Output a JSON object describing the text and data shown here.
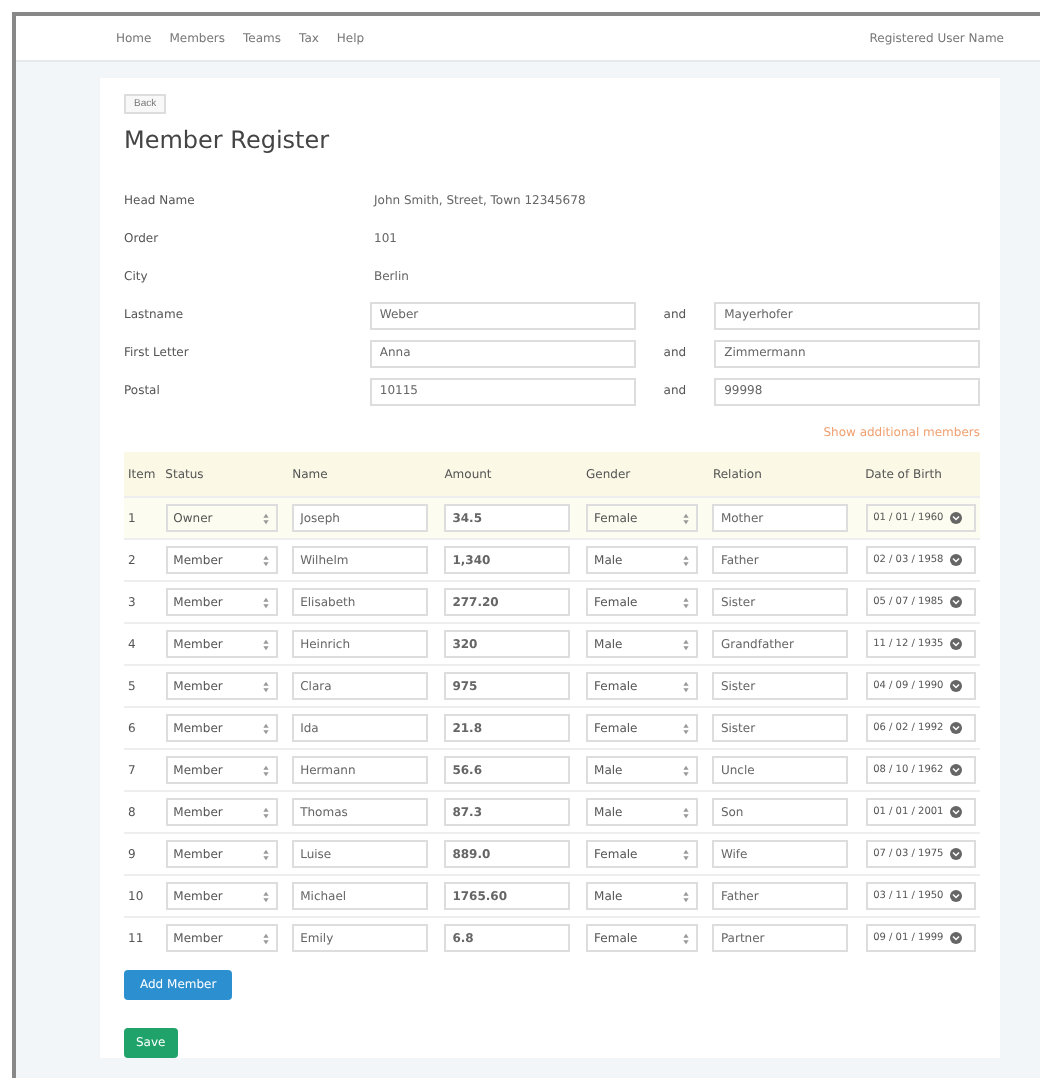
{
  "nav": {
    "links": [
      "Home",
      "Members",
      "Teams",
      "Tax",
      "Help"
    ],
    "user": "Registered User Name"
  },
  "back": "Back",
  "title": "Member Register",
  "info": [
    {
      "label": "Head Name",
      "value": "John Smith, Street, Town 12345678"
    },
    {
      "label": "Order",
      "value": "101"
    },
    {
      "label": "City",
      "value": "Berlin"
    }
  ],
  "ranges": [
    {
      "label": "Lastname",
      "from": "Weber",
      "sep": "and",
      "to": "Mayerhofer"
    },
    {
      "label": "First Letter",
      "from": "Anna",
      "sep": "and",
      "to": "Zimmermann"
    },
    {
      "label": "Postal",
      "from": "10115",
      "sep": "and",
      "to": "99998"
    }
  ],
  "link": "Show additional members",
  "columns": [
    "Item",
    "Status",
    "Name",
    "Amount",
    "Gender",
    "Relation",
    "Date of Birth"
  ],
  "rows": [
    {
      "item": "1",
      "status": "Owner",
      "name": "Joseph",
      "amount": "34.5",
      "gender": "Female",
      "relation": "Mother",
      "dob": "01 / 01 / 1960",
      "selected": true
    },
    {
      "item": "2",
      "status": "Member",
      "name": "Wilhelm",
      "amount": "1,340",
      "gender": "Male",
      "relation": "Father",
      "dob": "02 / 03 / 1958",
      "selected": false
    },
    {
      "item": "3",
      "status": "Member",
      "name": "Elisabeth",
      "amount": "277.20",
      "gender": "Female",
      "relation": "Sister",
      "dob": "05 / 07 / 1985",
      "selected": false
    },
    {
      "item": "4",
      "status": "Member",
      "name": "Heinrich",
      "amount": "320",
      "gender": "Male",
      "relation": "Grandfather",
      "dob": "11 / 12 / 1935",
      "selected": false
    },
    {
      "item": "5",
      "status": "Member",
      "name": "Clara",
      "amount": "975",
      "gender": "Female",
      "relation": "Sister",
      "dob": "04 / 09 / 1990",
      "selected": false
    },
    {
      "item": "6",
      "status": "Member",
      "name": "Ida",
      "amount": "21.8",
      "gender": "Female",
      "relation": "Sister",
      "dob": "06 / 02 / 1992",
      "selected": false
    },
    {
      "item": "7",
      "status": "Member",
      "name": "Hermann",
      "amount": "56.6",
      "gender": "Male",
      "relation": "Uncle",
      "dob": "08 / 10 / 1962",
      "selected": false
    },
    {
      "item": "8",
      "status": "Member",
      "name": "Thomas",
      "amount": "87.3",
      "gender": "Male",
      "relation": "Son",
      "dob": "01 / 01 / 2001",
      "selected": false
    },
    {
      "item": "9",
      "status": "Member",
      "name": "Luise",
      "amount": "889.0",
      "gender": "Female",
      "relation": "Wife",
      "dob": "07 / 03 / 1975",
      "selected": false
    },
    {
      "item": "10",
      "status": "Member",
      "name": "Michael",
      "amount": "1765.60",
      "gender": "Male",
      "relation": "Father",
      "dob": "03 / 11 / 1950",
      "selected": false
    },
    {
      "item": "11",
      "status": "Member",
      "name": "Emily",
      "amount": "6.8",
      "gender": "Female",
      "relation": "Partner",
      "dob": "09 / 01 / 1999",
      "selected": false
    }
  ],
  "add_button": "Add Member",
  "save_button": "Save"
}
